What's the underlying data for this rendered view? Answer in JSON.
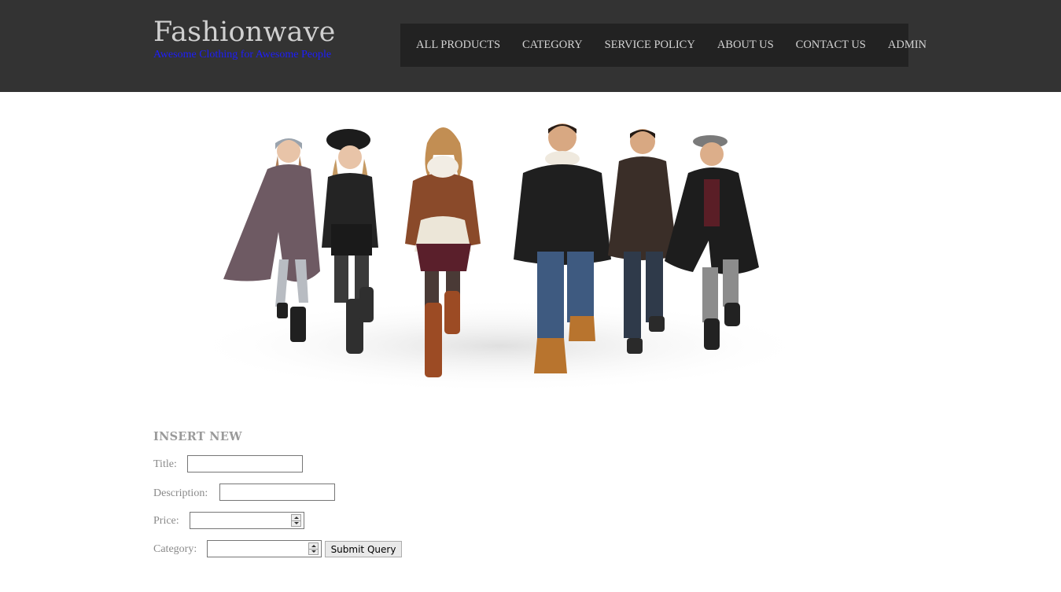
{
  "brand": {
    "title": "Fashionwave",
    "tagline": "Awesome Clothing for Awesome People"
  },
  "nav": {
    "items": [
      "ALL PRODUCTS",
      "CATEGORY",
      "SERVICE POLICY",
      "ABOUT US",
      "CONTACT US",
      "ADMIN"
    ]
  },
  "form": {
    "heading": "INSERT NEW",
    "title_label": "Title:",
    "title_value": "",
    "description_label": "Description:",
    "description_value": "",
    "price_label": "Price:",
    "price_value": "",
    "category_label": "Category:",
    "category_value": "",
    "submit_label": "Submit Query"
  },
  "colors": {
    "header_bg": "#333333",
    "nav_bg": "#222222",
    "tagline": "#1d1dff",
    "nav_text": "#d3d3d3"
  }
}
